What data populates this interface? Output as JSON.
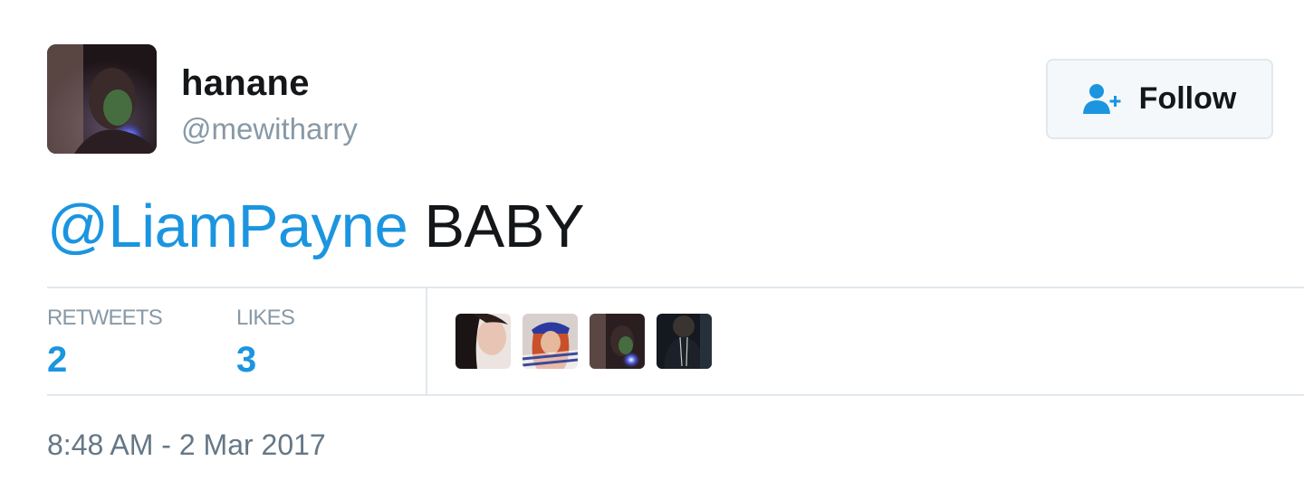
{
  "author": {
    "display_name": "hanane",
    "handle": "@mewitharry"
  },
  "follow_button": {
    "label": "Follow",
    "icon": "follow-user-icon"
  },
  "tweet": {
    "mention": "@LiamPayne",
    "text": " BABY"
  },
  "stats": {
    "retweets_label": "RETWEETS",
    "retweets_count": "2",
    "likes_label": "LIKES",
    "likes_count": "3"
  },
  "timestamp": "8:48 AM - 2 Mar 2017",
  "colors": {
    "link_blue": "#1b95e0",
    "muted_gray": "#8899a6",
    "border": "#e1e8ed"
  }
}
